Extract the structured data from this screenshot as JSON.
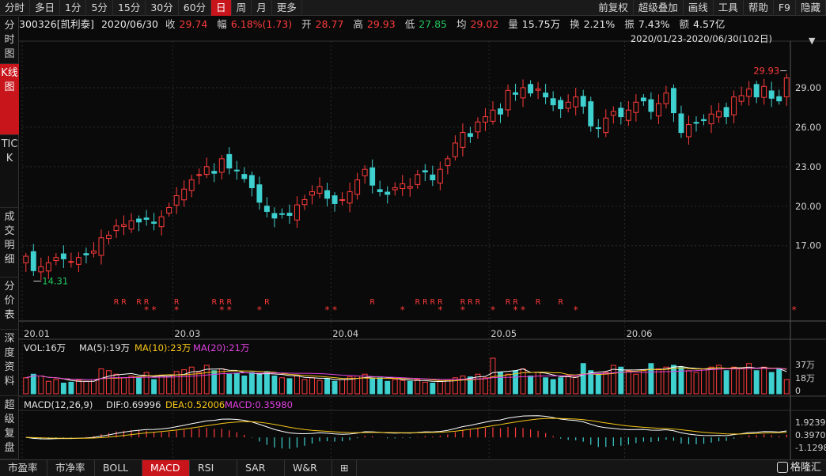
{
  "toolbar": {
    "items": [
      {
        "label": "分时"
      },
      {
        "label": "多日"
      },
      {
        "label": "1分"
      },
      {
        "label": "5分"
      },
      {
        "label": "15分"
      },
      {
        "label": "30分"
      },
      {
        "label": "60分"
      },
      {
        "label": "日",
        "active": true
      },
      {
        "label": "周"
      },
      {
        "label": "月"
      },
      {
        "label": "更多"
      }
    ],
    "right_items": [
      {
        "label": "前复权"
      },
      {
        "label": "超级叠加"
      },
      {
        "label": "画线"
      },
      {
        "label": "工具"
      },
      {
        "label": "帮助"
      },
      {
        "label": "F9"
      },
      {
        "label": "隐藏"
      }
    ]
  },
  "stock": {
    "code_name": "300326[凯利泰]",
    "date": "2020/06/30",
    "close_label": "收",
    "close": "29.74",
    "change_label": "幅",
    "change": "6.18%(1.73)",
    "open_label": "开",
    "open": "28.77",
    "high_label": "高",
    "high": "29.93",
    "low_label": "低",
    "low": "27.85",
    "avg_label": "均",
    "avg": "29.02",
    "volume_label": "量",
    "volume": "15.75万",
    "turnover_label": "换",
    "turnover": "2.21%",
    "amplitude_label": "振",
    "amplitude": "7.43%",
    "amount_label": "额",
    "amount": "4.57亿"
  },
  "range_label": "2020/01/23-2020/06/30(102日)",
  "left_tabs": [
    {
      "label": "分时图"
    },
    {
      "label": "K线图",
      "active": true
    },
    {
      "label": "TICK"
    },
    {
      "label": "成交明细"
    },
    {
      "label": "分价表"
    },
    {
      "label": "深度资料"
    },
    {
      "label": "超级复盘"
    }
  ],
  "bottom_tabs": [
    {
      "label": "市盈率"
    },
    {
      "label": "市净率"
    },
    {
      "label": "BOLL"
    },
    {
      "label": "MACD",
      "active": true
    },
    {
      "label": "RSI"
    },
    {
      "label": "SAR"
    },
    {
      "label": "W&R"
    },
    {
      "label": "⊞"
    }
  ],
  "brand": "格隆汇",
  "colors": {
    "up": "#ff3b3b",
    "down": "#3fd0d0",
    "ma5": "#ffffff",
    "ma10": "#f5c518",
    "ma20": "#e040e0",
    "accent": "#c8151b"
  },
  "chart_data": {
    "type": "candlestick",
    "y_axis_ticks": [
      "29.00",
      "26.00",
      "23.00",
      "20.00",
      "17.00"
    ],
    "y_axis_values": [
      29,
      26,
      23,
      20,
      17
    ],
    "ylim": [
      13.5,
      30.8
    ],
    "x_axis_labels": [
      {
        "label": "20.01",
        "index": 0
      },
      {
        "label": "20.03",
        "index": 20
      },
      {
        "label": "20.04",
        "index": 41
      },
      {
        "label": "20.05",
        "index": 62
      },
      {
        "label": "20.06",
        "index": 80
      }
    ],
    "max_annotation": "29.93",
    "min_annotation": "14.31",
    "closes": [
      16.2,
      15.1,
      15.4,
      15.7,
      16.1,
      16.0,
      15.8,
      16.1,
      16.3,
      16.6,
      17.6,
      17.8,
      18.5,
      18.6,
      18.9,
      18.8,
      19.0,
      18.7,
      19.2,
      19.9,
      20.8,
      21.3,
      22.0,
      22.4,
      23.0,
      22.5,
      23.6,
      22.9,
      22.7,
      22.1,
      21.4,
      20.3,
      19.6,
      19.1,
      19.4,
      19.3,
      20.1,
      20.5,
      21.1,
      21.5,
      20.6,
      20.2,
      20.5,
      21.1,
      22.0,
      22.8,
      21.6,
      21.1,
      20.9,
      21.4,
      21.7,
      21.5,
      22.4,
      22.6,
      22.0,
      22.8,
      23.6,
      24.8,
      25.6,
      25.3,
      26.4,
      26.8,
      27.3,
      27.0,
      28.8,
      28.5,
      29.0,
      28.6,
      28.9,
      28.3,
      27.7,
      27.4,
      27.9,
      28.3,
      27.6,
      26.1,
      25.9,
      26.7,
      27.2,
      26.8,
      27.3,
      27.9,
      28.0,
      27.2,
      27.8,
      28.6,
      27.1,
      25.6,
      26.2,
      26.3,
      26.5,
      27.0,
      27.2,
      26.8,
      28.3,
      28.4,
      28.9,
      28.3,
      29.1,
      28.2,
      28.0,
      29.74
    ],
    "signals_R": [
      12,
      13,
      15,
      16,
      20,
      25,
      26,
      27,
      32,
      46,
      52,
      53,
      54,
      55,
      58,
      59,
      60,
      64,
      65,
      68,
      71
    ],
    "signals_star": [
      16,
      17,
      20,
      26,
      27,
      31,
      40,
      41,
      50,
      55,
      58,
      62,
      65,
      66,
      73,
      102
    ],
    "volume": {
      "label": "VOL:16万",
      "ma5_label": "MA(5):19万",
      "ma10_label": "MA(10):23万",
      "ma20_label": "MA(20):21万",
      "ticks": [
        "37万",
        "18万",
        "0"
      ],
      "ylim": [
        0,
        40
      ],
      "values": [
        18,
        22,
        20,
        14,
        16,
        12,
        13,
        15,
        14,
        16,
        28,
        26,
        22,
        18,
        20,
        19,
        24,
        16,
        21,
        20,
        25,
        27,
        30,
        24,
        32,
        26,
        28,
        22,
        23,
        20,
        24,
        22,
        25,
        20,
        18,
        17,
        21,
        16,
        18,
        15,
        17,
        14,
        16,
        19,
        20,
        22,
        17,
        18,
        14,
        16,
        15,
        14,
        16,
        13,
        12,
        14,
        16,
        18,
        20,
        19,
        22,
        18,
        40,
        24,
        22,
        26,
        28,
        20,
        24,
        18,
        16,
        18,
        20,
        19,
        34,
        26,
        22,
        24,
        32,
        30,
        26,
        22,
        26,
        34,
        28,
        30,
        32,
        30,
        26,
        24,
        28,
        30,
        32,
        26,
        30,
        28,
        34,
        26,
        30,
        24,
        28,
        16
      ]
    },
    "macd": {
      "label": "MACD(12,26,9)",
      "dif_label": "DIF:0.69996",
      "dea_label": "DEA:0.52006",
      "macd_label": "MACD:0.35980",
      "ticks": [
        "1.92393",
        "0.39704",
        "-1.12985"
      ],
      "ylim": [
        -1.3,
        2.2
      ]
    }
  }
}
